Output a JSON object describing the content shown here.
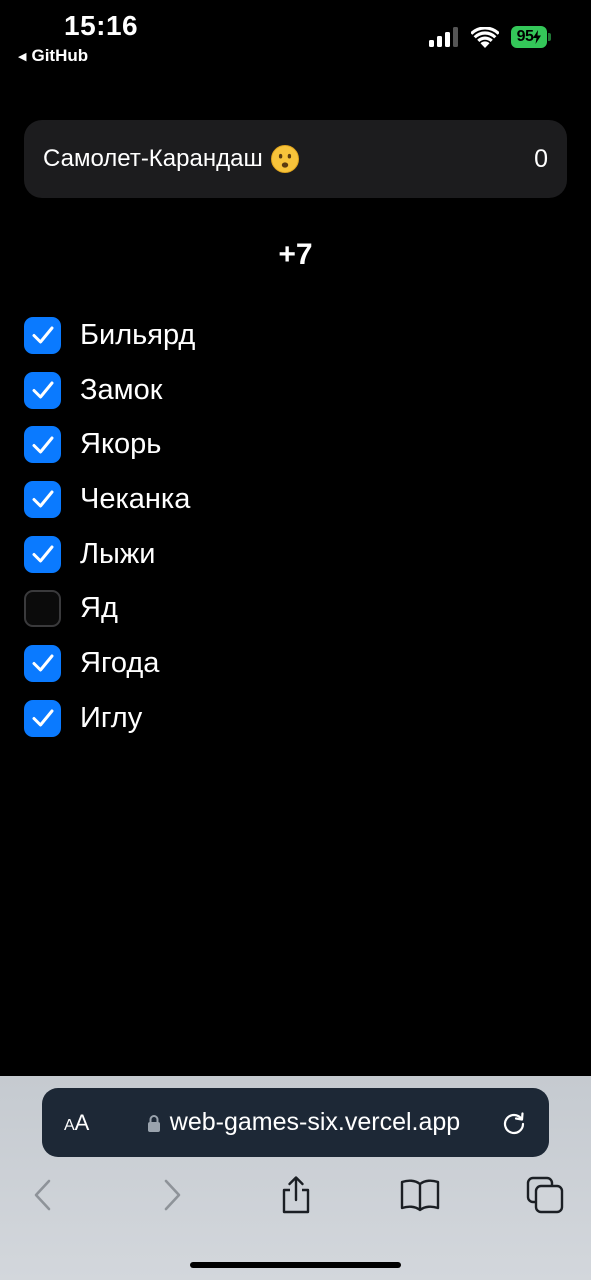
{
  "status_bar": {
    "time": "15:16",
    "back_app": "GitHub",
    "battery": "95"
  },
  "player": {
    "name": "Самолет-Карандаш",
    "emoji": "frowning-face-emoji",
    "score": "0"
  },
  "round_score": "+7",
  "words": [
    {
      "label": "Бильярд",
      "checked": true
    },
    {
      "label": "Замок",
      "checked": true
    },
    {
      "label": "Якорь",
      "checked": true
    },
    {
      "label": "Чеканка",
      "checked": true
    },
    {
      "label": "Лыжи",
      "checked": true
    },
    {
      "label": "Яд",
      "checked": false
    },
    {
      "label": "Ягода",
      "checked": true
    },
    {
      "label": "Иглу",
      "checked": true
    }
  ],
  "browser": {
    "aa_label_small": "A",
    "aa_label_large": "A",
    "url": "web-games-six.vercel.app"
  },
  "colors": {
    "accent": "#0a7aff",
    "card_bg": "#1c1c1e",
    "battery": "#34c759"
  }
}
